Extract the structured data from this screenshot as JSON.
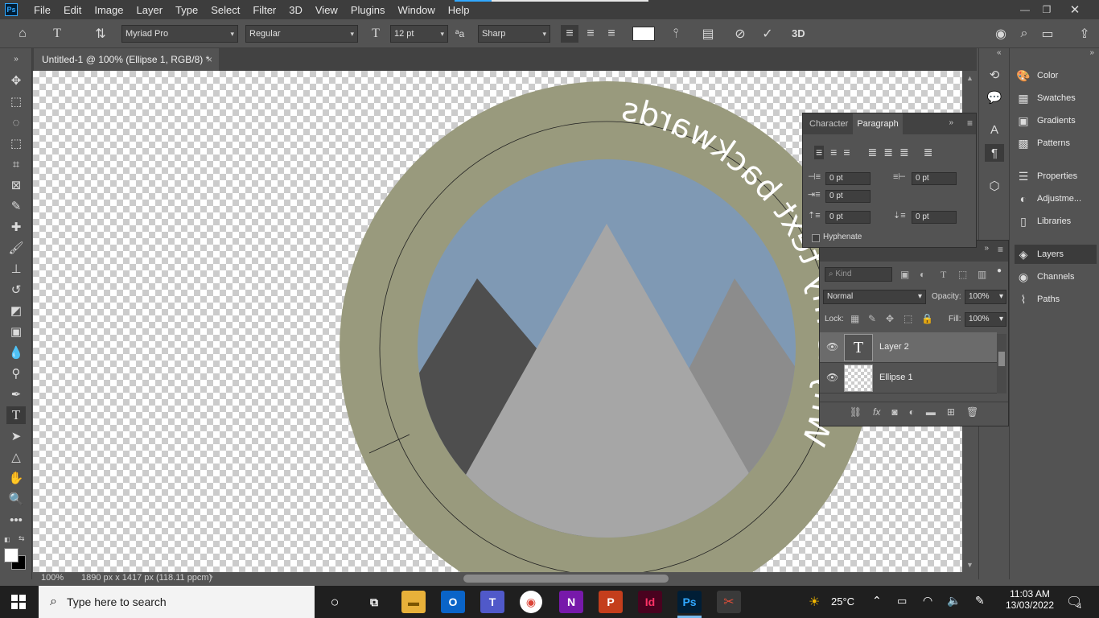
{
  "app": {
    "logo_text": "Ps"
  },
  "menu": [
    "File",
    "Edit",
    "Image",
    "Layer",
    "Type",
    "Select",
    "Filter",
    "3D",
    "View",
    "Plugins",
    "Window",
    "Help"
  ],
  "options_bar": {
    "font_family": "Myriad Pro",
    "font_style": "Regular",
    "font_size": "12 pt",
    "antialias_label": "ªa",
    "antialias": "Sharp",
    "three_d_label": "3D"
  },
  "document": {
    "tab_title": "Untitled-1 @ 100% (Ellipse 1, RGB/8) *",
    "canvas_text": "Why is my text backwards"
  },
  "status": {
    "zoom": "100%",
    "doc_info": "1890 px x 1417 px (118.11 ppcm)"
  },
  "right_panel": {
    "items": [
      "Color",
      "Swatches",
      "Gradients",
      "Patterns",
      "Properties",
      "Adjustme...",
      "Libraries"
    ],
    "layers_group": [
      "Layers",
      "Channels",
      "Paths"
    ]
  },
  "paragraph_panel": {
    "tab_character": "Character",
    "tab_paragraph": "Paragraph",
    "indent_left": "0 pt",
    "indent_right": "0 pt",
    "indent_first": "0 pt",
    "space_before": "0 pt",
    "space_after": "0 pt",
    "hyphenate_label": "Hyphenate"
  },
  "layers_panel": {
    "filter_placeholder": "Kind",
    "blend_mode": "Normal",
    "opacity_label": "Opacity:",
    "opacity": "100%",
    "lock_label": "Lock:",
    "fill_label": "Fill:",
    "fill": "100%",
    "layers": [
      {
        "name": "Layer 2",
        "type_glyph": "T"
      },
      {
        "name": "Ellipse 1"
      }
    ]
  },
  "taskbar": {
    "search_placeholder": "Type here to search",
    "weather": "25°C",
    "time": "11:03 AM",
    "date": "13/03/2022",
    "notification_count": "4",
    "apps": [
      "Id",
      "Ps"
    ]
  },
  "colors": {
    "canvas_ring": "#999a7d",
    "sky": "#7f99b4",
    "mountain_dark": "#4e4e4e",
    "mountain_mid": "#a6a6a6",
    "mountain_right": "#8c8c8c",
    "ps_accent": "#31a8ff"
  }
}
